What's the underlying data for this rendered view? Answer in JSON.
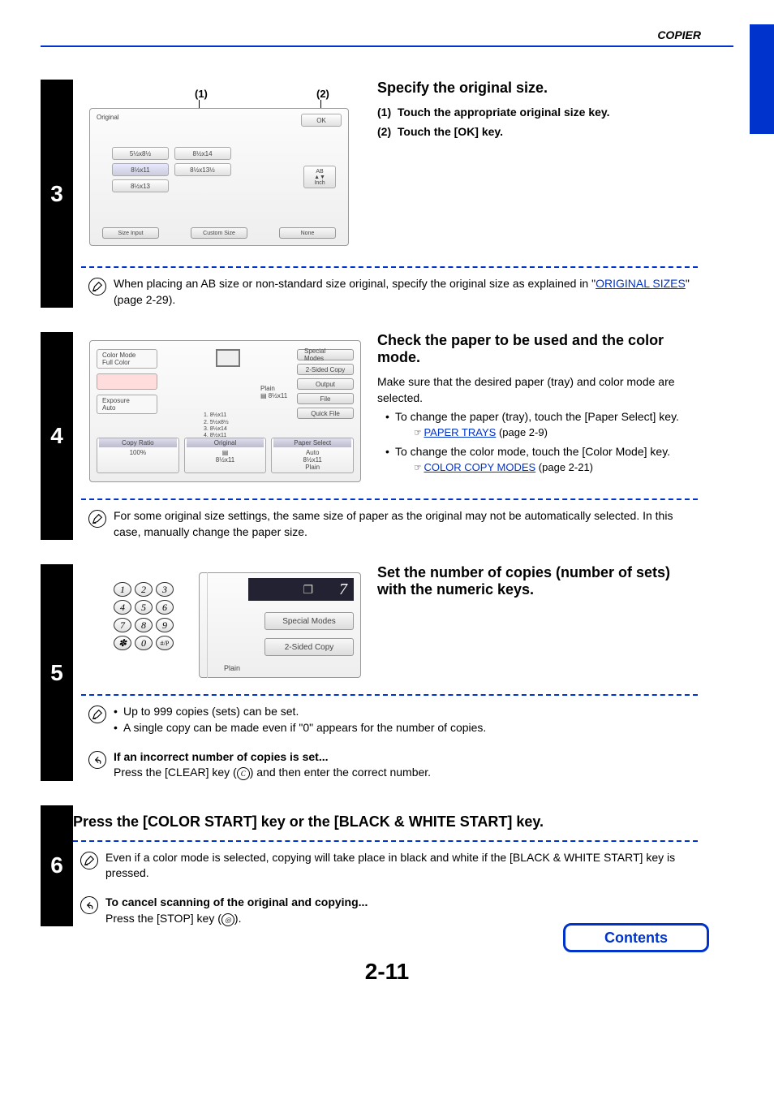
{
  "header": {
    "section": "COPIER"
  },
  "step3": {
    "number": "3",
    "heading": "Specify the original size.",
    "sub1_num": "(1)",
    "sub1_text": "Touch the appropriate original size key.",
    "sub2_num": "(2)",
    "sub2_text": "Touch the [OK] key.",
    "note": "When placing an AB size or non-standard size original, specify the original size as explained in \"",
    "note_link": "ORIGINAL SIZES",
    "note_tail": "\" (page 2-29).",
    "callout1": "(1)",
    "callout2": "(2)",
    "d": {
      "title": "Original",
      "ok": "OK",
      "s1": "5½x8½",
      "s2": "8½x14",
      "s3": "8½x11",
      "s4": "8½x13½",
      "s5": "8½x13",
      "ab": "AB",
      "inch": "Inch",
      "b1": "Size Input",
      "b2": "Custom Size",
      "b3": "None"
    }
  },
  "step4": {
    "number": "4",
    "heading": "Check the paper to be used and the color mode.",
    "p1": "Make sure that the desired paper (tray) and color mode are selected.",
    "li1": "To change the paper (tray), touch the [Paper Select] key.",
    "xref1_icon": "☞",
    "xref1_link": "PAPER TRAYS",
    "xref1_tail": " (page 2-9)",
    "li2": "To change the color mode, touch the [Color Mode] key.",
    "xref2_icon": "☞",
    "xref2_link": "COLOR COPY MODES",
    "xref2_tail": " (page 2-21)",
    "note": "For some original size settings, the same size of paper as the original may not be automatically selected. In this case, manually change the paper size.",
    "d": {
      "cm_h": "Color Mode",
      "cm_v": "Full Color",
      "exp_h": "Exposure",
      "exp_v": "Auto",
      "cr_h": "Copy Ratio",
      "cr_v": "100%",
      "orig": "Original",
      "orig_v": "8½x11",
      "ps_h": "Paper Select",
      "ps_v1": "Auto",
      "ps_v2": "8½x11",
      "ps_v3": "Plain",
      "r1": "Special Modes",
      "r2": "2-Sided Copy",
      "r3": "Output",
      "r4": "File",
      "r5": "Quick File",
      "plain": "Plain",
      "plain2": "8½x11",
      "t1": "1. 8½x11",
      "t2": "2. 5½x8½",
      "t3": "3. 8½x14",
      "t4": "4. 8½x11"
    }
  },
  "step5": {
    "number": "5",
    "heading": "Set the number of copies (number of sets) with the numeric keys.",
    "note_li1": "Up to 999 copies (sets) can be set.",
    "note_li2": "A single copy can be made even if \"0\" appears for the number of copies.",
    "stop_h": "If an incorrect number of copies is set...",
    "stop_t": "Press the [CLEAR] key (",
    "stop_key": "C",
    "stop_t2": ") and then enter the correct number.",
    "d": {
      "count": "7",
      "plain": "Plain",
      "r1": "Special Modes",
      "r2": "2-Sided Copy",
      "k": [
        "1",
        "2",
        "3",
        "4",
        "5",
        "6",
        "7",
        "8",
        "9",
        "✽",
        "0",
        "#/P"
      ]
    }
  },
  "step6": {
    "number": "6",
    "heading": "Press the [COLOR START] key or the [BLACK & WHITE START] key.",
    "note": "Even if a color mode is selected, copying will take place in black and white if the [BLACK & WHITE START] key is pressed.",
    "stop_h": "To cancel scanning of the original and copying...",
    "stop_t": "Press the [STOP] key (",
    "stop_key": "◎",
    "stop_t2": ")."
  },
  "footer": {
    "pagenum": "2-11",
    "contents": "Contents"
  }
}
